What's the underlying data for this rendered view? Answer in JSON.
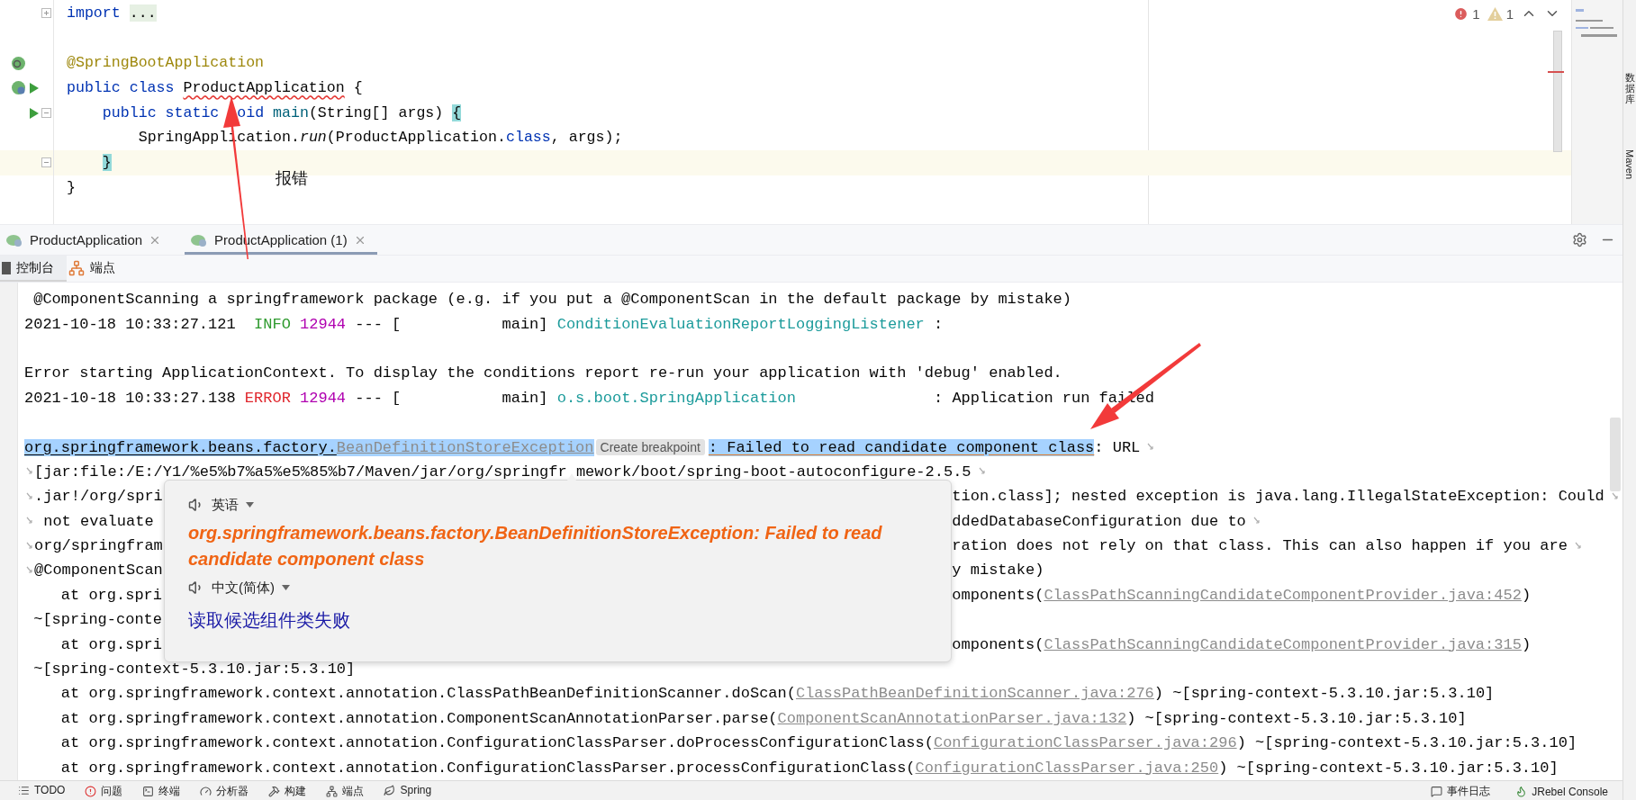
{
  "editor": {
    "lines": [
      {
        "current": false,
        "tokens": [
          {
            "text": "import ",
            "kind": "keyword"
          },
          {
            "text": "...",
            "kind": "folded"
          }
        ]
      },
      {
        "current": false
      },
      {
        "current": false,
        "tokens": [
          {
            "text": "@SpringBootApplication",
            "kind": "annotation"
          }
        ]
      },
      {
        "current": false,
        "tokens": [
          {
            "text": "public class ",
            "kind": "keyword"
          },
          {
            "text": "ProductApplication",
            "kind": "error"
          },
          {
            "text": " {",
            "kind": "plain"
          }
        ]
      },
      {
        "current": false,
        "tokens": [
          {
            "text": "    public static ",
            "kind": "keyword"
          },
          {
            "text": "oid ",
            "kind": "keyword-after-gap"
          },
          {
            "text": "main",
            "kind": "method"
          },
          {
            "text": "(String[] args) ",
            "kind": "plain"
          },
          {
            "text": "{",
            "kind": "match"
          }
        ]
      },
      {
        "current": false,
        "tokens": [
          {
            "text": "        SpringApplication.",
            "kind": "plain"
          },
          {
            "text": "run",
            "kind": "italic"
          },
          {
            "text": "(ProductApplication.",
            "kind": "plain"
          },
          {
            "text": "class",
            "kind": "keyword"
          },
          {
            "text": ", args);",
            "kind": "plain"
          }
        ]
      },
      {
        "current": true,
        "tokens": [
          {
            "text": "    }",
            "kind": "match"
          }
        ]
      },
      {
        "current": false,
        "tokens": [
          {
            "text": "}",
            "kind": "plain"
          }
        ]
      }
    ],
    "error_count": "1",
    "warning_count": "1"
  },
  "annotation_note": "报错",
  "run_tabs": [
    {
      "label": "ProductApplication",
      "selected": false
    },
    {
      "label": "ProductApplication (1)",
      "selected": true
    }
  ],
  "console_tabs": [
    {
      "label": "控制台",
      "selected": true
    },
    {
      "label": "端点",
      "selected": false
    }
  ],
  "console": {
    "lines": [
      {
        "kind": "text",
        "gap_before": false,
        "wrap_start": false,
        "wrap_end": false,
        "segments": [
          {
            "text": " @ComponentScanning a springframework package (e.g. if you put a @ComponentScan in the default package by mistake)",
            "kind": "plain"
          }
        ]
      },
      {
        "kind": "text",
        "gap_before": false,
        "wrap_start": false,
        "wrap_end": false,
        "segments": [
          {
            "text": "2021-10-18 10:33:27.121  ",
            "kind": "plain"
          },
          {
            "text": "INFO ",
            "kind": "info"
          },
          {
            "text": "12944",
            "kind": "pid"
          },
          {
            "text": " --- [           main] ",
            "kind": "plain"
          },
          {
            "text": "ConditionEvaluationReportLoggingListener",
            "kind": "logger"
          },
          {
            "text": " :",
            "kind": "plain"
          }
        ]
      },
      {
        "kind": "text",
        "gap_before": true,
        "wrap_start": false,
        "wrap_end": false,
        "segments": [
          {
            "text": "Error starting ApplicationContext. To display the conditions report re-run your application with 'debug' enabled.",
            "kind": "plain"
          }
        ]
      },
      {
        "kind": "text",
        "gap_before": false,
        "wrap_start": false,
        "wrap_end": false,
        "segments": [
          {
            "text": "2021-10-18 10:33:27.138 ",
            "kind": "plain"
          },
          {
            "text": "ERROR ",
            "kind": "error"
          },
          {
            "text": "12944",
            "kind": "pid"
          },
          {
            "text": " --- [           main] ",
            "kind": "plain"
          },
          {
            "text": "o.s.boot.SpringApplication",
            "kind": "logger"
          },
          {
            "text": "               : Application run failed",
            "kind": "plain"
          }
        ]
      },
      {
        "kind": "text",
        "gap_before": true,
        "wrap_start": false,
        "wrap_end": true,
        "segments": [
          {
            "text": "org.springframework.beans.factory.",
            "kind": "selected"
          },
          {
            "text": "BeanDefinitionStoreException",
            "kind": "selected-link"
          },
          {
            "text": "Create breakpoint",
            "kind": "chip"
          },
          {
            "text": ": Failed to read candidate component class",
            "kind": "selected-underlined"
          },
          {
            "text": ": URL",
            "kind": "plain"
          }
        ]
      },
      {
        "kind": "text",
        "gap_before": false,
        "wrap_start": true,
        "wrap_end": true,
        "segments": [
          {
            "text": "[jar:file:/E:/Y1/%e5%b7%a5%e5%85%b7/Maven/jar/org/springfr",
            "kind": "plain"
          },
          {
            "text": "mework/boot/spring-boot-autoconfigure-2.5.5",
            "kind": "after-gap"
          }
        ]
      },
      {
        "kind": "split",
        "gap_before": false,
        "wrap_start": true,
        "wrap_end": true,
        "segments": [
          {
            "text": ".jar!/org/spri",
            "kind": "plain"
          }
        ],
        "after_popup": [
          {
            "text": "tion.class]; nested exception is java.lang.IllegalStateException: Could",
            "kind": "plain"
          }
        ]
      },
      {
        "kind": "split",
        "gap_before": false,
        "wrap_start": true,
        "wrap_end": true,
        "segments": [
          {
            "text": " not evaluate ",
            "kind": "plain"
          }
        ],
        "after_popup": [
          {
            "text": "ddedDatabaseConfiguration due to",
            "kind": "plain"
          }
        ]
      },
      {
        "kind": "split",
        "gap_before": false,
        "wrap_start": true,
        "wrap_end": true,
        "segments": [
          {
            "text": "org/springfram",
            "kind": "plain"
          }
        ],
        "after_popup": [
          {
            "text": "ration does not rely on that class. This can also happen if you are",
            "kind": "plain"
          }
        ]
      },
      {
        "kind": "split",
        "gap_before": false,
        "wrap_start": true,
        "wrap_end": false,
        "segments": [
          {
            "text": "@ComponentScan",
            "kind": "plain"
          }
        ],
        "after_popup": [
          {
            "text": "y mistake)",
            "kind": "plain"
          }
        ]
      },
      {
        "kind": "split",
        "gap_before": false,
        "wrap_start": false,
        "wrap_end": false,
        "segments": [
          {
            "text": "    at org.spri",
            "kind": "plain"
          }
        ],
        "after_popup": [
          {
            "text": "omponents(",
            "kind": "plain"
          },
          {
            "text": "ClassPathScanningCandidateComponentProvider.java:452",
            "kind": "link"
          },
          {
            "text": ")",
            "kind": "plain"
          }
        ]
      },
      {
        "kind": "split",
        "gap_before": false,
        "wrap_start": false,
        "wrap_end": false,
        "segments": [
          {
            "text": " ~[spring-conte",
            "kind": "plain"
          }
        ]
      },
      {
        "kind": "split",
        "gap_before": false,
        "wrap_start": false,
        "wrap_end": false,
        "segments": [
          {
            "text": "    at org.spri",
            "kind": "plain"
          }
        ],
        "after_popup": [
          {
            "text": "omponents(",
            "kind": "plain"
          },
          {
            "text": "ClassPathScanningCandidateComponentProvider.java:315",
            "kind": "link"
          },
          {
            "text": ")",
            "kind": "plain"
          }
        ]
      },
      {
        "kind": "text",
        "gap_before": false,
        "wrap_start": false,
        "wrap_end": false,
        "segments": [
          {
            "text": " ~[spring-context-5.3.10.jar:5.3.10]",
            "kind": "plain"
          }
        ]
      },
      {
        "kind": "text",
        "gap_before": false,
        "wrap_start": false,
        "wrap_end": false,
        "segments": [
          {
            "text": "    at org.springframework.context.annotation.ClassPathBeanDefinitionScanner.doScan(",
            "kind": "plain"
          },
          {
            "text": "ClassPathBeanDefinitionScanner.java:276",
            "kind": "link"
          },
          {
            "text": ") ~[spring-context-5.3.10.jar:5.3.10]",
            "kind": "plain"
          }
        ]
      },
      {
        "kind": "text",
        "gap_before": false,
        "wrap_start": false,
        "wrap_end": false,
        "segments": [
          {
            "text": "    at org.springframework.context.annotation.ComponentScanAnnotationParser.parse(",
            "kind": "plain"
          },
          {
            "text": "ComponentScanAnnotationParser.java:132",
            "kind": "link"
          },
          {
            "text": ") ~[spring-context-5.3.10.jar:5.3.10]",
            "kind": "plain"
          }
        ]
      },
      {
        "kind": "text",
        "gap_before": false,
        "wrap_start": false,
        "wrap_end": false,
        "segments": [
          {
            "text": "    at org.springframework.context.annotation.ConfigurationClassParser.doProcessConfigurationClass(",
            "kind": "plain"
          },
          {
            "text": "ConfigurationClassParser.java:296",
            "kind": "link"
          },
          {
            "text": ") ~[spring-context-5.3.10.jar:5.3.10]",
            "kind": "plain"
          }
        ]
      },
      {
        "kind": "text",
        "gap_before": false,
        "wrap_start": false,
        "wrap_end": false,
        "segments": [
          {
            "text": "    at org.springframework.context.annotation.ConfigurationClassParser.processConfigurationClass(",
            "kind": "plain"
          },
          {
            "text": "ConfigurationClassParser.java:250",
            "kind": "link"
          },
          {
            "text": ") ~[spring-context-5.3.10.jar:5.3.10]",
            "kind": "plain"
          }
        ]
      }
    ]
  },
  "translation_popup": {
    "source_language": "英语",
    "source_text": "org.springframework.beans.factory.BeanDefinitionStoreException: Failed to read candidate component class",
    "target_language": "中文(简体)",
    "target_text": "读取候选组件类失败"
  },
  "status_bar": {
    "left": [
      {
        "label": "TODO"
      },
      {
        "label": "问题"
      },
      {
        "label": "终端"
      },
      {
        "label": "分析器"
      },
      {
        "label": "构建"
      },
      {
        "label": "端点"
      },
      {
        "label": "Spring"
      }
    ],
    "right": [
      {
        "label": "事件日志"
      },
      {
        "label": "JRebel Console"
      }
    ]
  },
  "side_strip": [
    {
      "label": "数据库",
      "kind": "cjk"
    },
    {
      "label": "Maven",
      "kind": "latin"
    }
  ]
}
